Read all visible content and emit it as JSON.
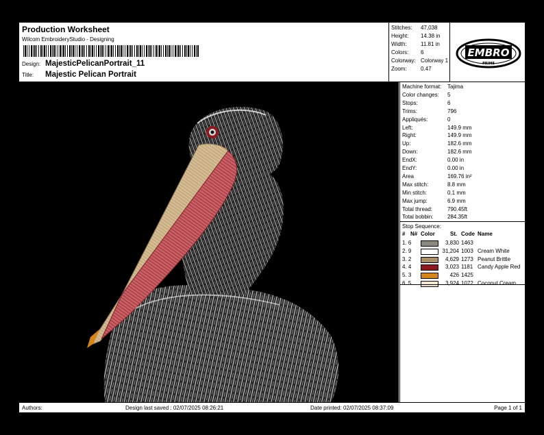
{
  "header": {
    "title": "Production Worksheet",
    "subtitle": "Wilcom EmbroideryStudio - Designing",
    "design_label": "Design:",
    "design_value": "MajesticPelicanPortrait_11",
    "title_label": "Title:",
    "title_value": "Majestic Pelican Portrait"
  },
  "stats": [
    {
      "k": "Stitches:",
      "v": "47,038"
    },
    {
      "k": "Height:",
      "v": "14.38 in"
    },
    {
      "k": "Width:",
      "v": "11.81 in"
    },
    {
      "k": "Colors:",
      "v": "6"
    },
    {
      "k": "Colorway:",
      "v": "Colorway 1"
    },
    {
      "k": "Zoom:",
      "v": "0.47"
    }
  ],
  "logo": {
    "main": "EMBRO",
    "sub": "PRIME"
  },
  "machine": [
    {
      "k": "Machine format:",
      "v": "Tajima"
    },
    {
      "k": "Color changes:",
      "v": "5"
    },
    {
      "k": "Stops:",
      "v": "6"
    },
    {
      "k": "Trims:",
      "v": "796"
    },
    {
      "k": "Appliqués:",
      "v": "0"
    },
    {
      "k": "Left:",
      "v": "149.9 mm"
    },
    {
      "k": "Right:",
      "v": "149.9 mm"
    },
    {
      "k": "Up:",
      "v": "182.6 mm"
    },
    {
      "k": "Down:",
      "v": "182.6 mm"
    },
    {
      "k": "EndX:",
      "v": "0.00 in"
    },
    {
      "k": "EndY:",
      "v": "0.00 in"
    },
    {
      "k": "Area",
      "v": "169.76 in²"
    },
    {
      "k": "Max stitch:",
      "v": "8.8 mm"
    },
    {
      "k": "Min stitch:",
      "v": "0.1 mm"
    },
    {
      "k": "Max jump:",
      "v": "6.9 mm"
    },
    {
      "k": "Total thread:",
      "v": "790.45ft"
    },
    {
      "k": "Total bobbin:",
      "v": "284.35ft"
    }
  ],
  "stop_sequence": {
    "title": "Stop Sequence:",
    "headers": {
      "num": "#",
      "n": "N#",
      "color": "Color",
      "st": "St.",
      "code": "Code",
      "name": "Name"
    },
    "rows": [
      {
        "idx": "1.  6",
        "color": "#8a8a80",
        "st": "3,830",
        "code": "1463",
        "name": ""
      },
      {
        "idx": "2.  9",
        "color": "#ffffff",
        "st": "31,204",
        "code": "1003",
        "name": "Cream White"
      },
      {
        "idx": "3.  2",
        "color": "#a98f6a",
        "st": "4,629",
        "code": "1273",
        "name": "Peanut Brittle"
      },
      {
        "idx": "4.  4",
        "color": "#8b1a20",
        "st": "3,023",
        "code": "1181",
        "name": "Candy Apple Red"
      },
      {
        "idx": "5.  3",
        "color": "#d4861a",
        "st": "426",
        "code": "1425",
        "name": ""
      },
      {
        "idx": "6.  5",
        "color": "#f4e6cf",
        "st": "3,924",
        "code": "1072",
        "name": "Coconut Cream"
      }
    ]
  },
  "footer": {
    "authors": "Authors:",
    "last_saved": "Design last saved : 02/07/2025 08:26:21",
    "printed": "Date printed: 02/07/2025 08:37:09",
    "page": "Page 1 of 1"
  }
}
